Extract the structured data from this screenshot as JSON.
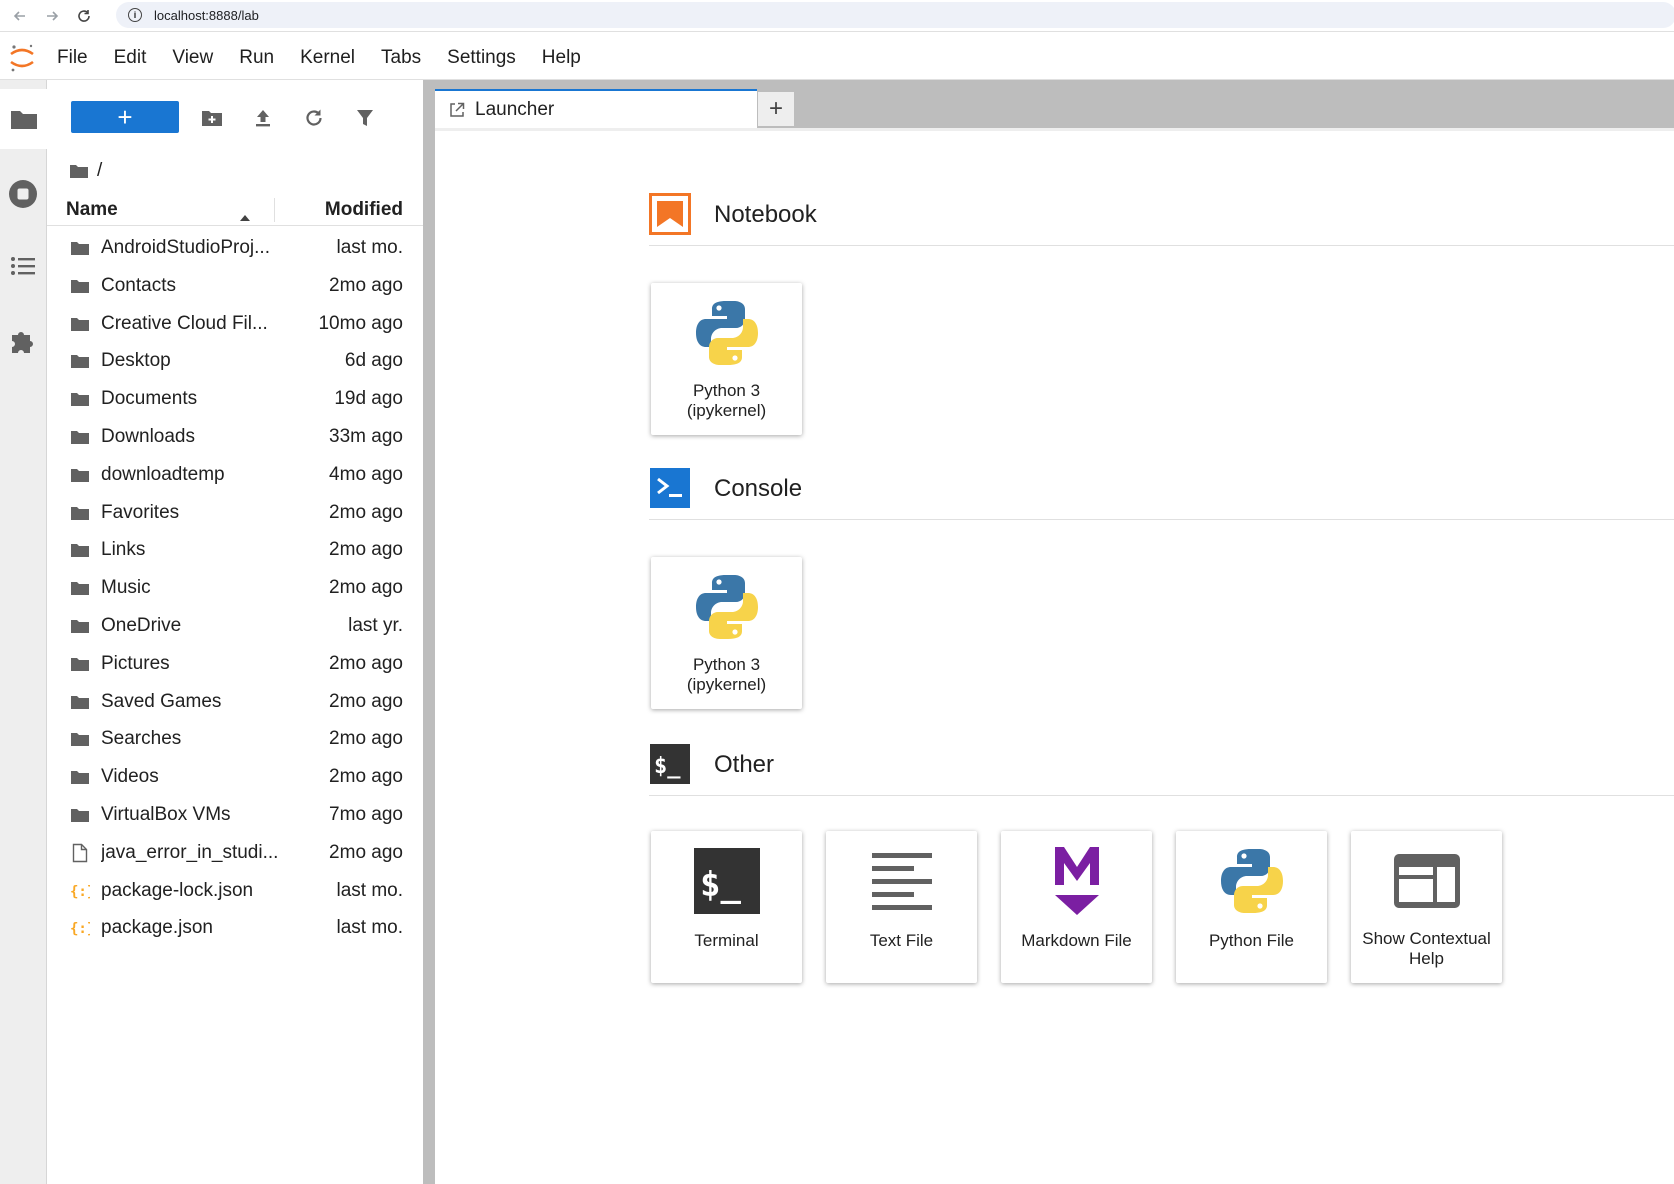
{
  "browser": {
    "url": "localhost:8888/lab",
    "info_glyph": "i"
  },
  "menu": {
    "items": [
      "File",
      "Edit",
      "View",
      "Run",
      "Kernel",
      "Tabs",
      "Settings",
      "Help"
    ]
  },
  "file_browser": {
    "new_button_label": "+",
    "breadcrumb": "/",
    "columns": {
      "name": "Name",
      "modified": "Modified"
    },
    "files": [
      {
        "name": "AndroidStudioProj...",
        "modified": "last mo.",
        "type": "folder"
      },
      {
        "name": "Contacts",
        "modified": "2mo ago",
        "type": "folder"
      },
      {
        "name": "Creative Cloud Fil...",
        "modified": "10mo ago",
        "type": "folder"
      },
      {
        "name": "Desktop",
        "modified": "6d ago",
        "type": "folder"
      },
      {
        "name": "Documents",
        "modified": "19d ago",
        "type": "folder"
      },
      {
        "name": "Downloads",
        "modified": "33m ago",
        "type": "folder"
      },
      {
        "name": "downloadtemp",
        "modified": "4mo ago",
        "type": "folder"
      },
      {
        "name": "Favorites",
        "modified": "2mo ago",
        "type": "folder"
      },
      {
        "name": "Links",
        "modified": "2mo ago",
        "type": "folder"
      },
      {
        "name": "Music",
        "modified": "2mo ago",
        "type": "folder"
      },
      {
        "name": "OneDrive",
        "modified": "last yr.",
        "type": "folder"
      },
      {
        "name": "Pictures",
        "modified": "2mo ago",
        "type": "folder"
      },
      {
        "name": "Saved Games",
        "modified": "2mo ago",
        "type": "folder"
      },
      {
        "name": "Searches",
        "modified": "2mo ago",
        "type": "folder"
      },
      {
        "name": "Videos",
        "modified": "2mo ago",
        "type": "folder"
      },
      {
        "name": "VirtualBox VMs",
        "modified": "7mo ago",
        "type": "folder"
      },
      {
        "name": "java_error_in_studi...",
        "modified": "2mo ago",
        "type": "file"
      },
      {
        "name": "package-lock.json",
        "modified": "last mo.",
        "type": "json"
      },
      {
        "name": "package.json",
        "modified": "last mo.",
        "type": "json"
      }
    ]
  },
  "tabs": {
    "active": "Launcher",
    "new_tab_label": "+"
  },
  "launcher": {
    "sections": {
      "notebook": "Notebook",
      "console": "Console",
      "other": "Other"
    },
    "notebook_cards": [
      {
        "line1": "Python 3",
        "line2": "(ipykernel)"
      }
    ],
    "console_cards": [
      {
        "line1": "Python 3",
        "line2": "(ipykernel)"
      }
    ],
    "other_cards": [
      {
        "label": "Terminal",
        "icon": "terminal-icon"
      },
      {
        "label": "Text File",
        "icon": "text-file-icon"
      },
      {
        "label": "Markdown File",
        "icon": "markdown-icon"
      },
      {
        "label": "Python File",
        "icon": "python-icon"
      },
      {
        "label": "Show Contextual Help",
        "icon": "contextual-help-icon"
      }
    ]
  },
  "colors": {
    "accent": "#1976d2",
    "notebook_orange": "#f37626",
    "markdown_purple": "#7b1fa2",
    "python_blue": "#3b77a8",
    "python_yellow": "#f7d34a"
  }
}
